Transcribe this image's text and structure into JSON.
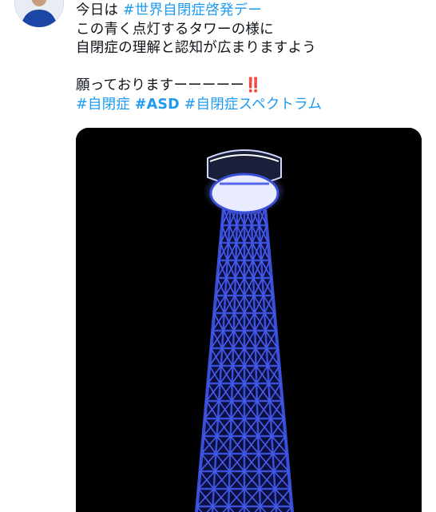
{
  "tweet": {
    "avatar_icon": "user-avatar",
    "lines": [
      {
        "parts": [
          {
            "text": "今日は "
          },
          {
            "text": "#世界自閉症啓発デー",
            "hashtag": true
          }
        ]
      },
      {
        "parts": [
          {
            "text": "この青く点灯するタワーの様に"
          }
        ]
      },
      {
        "parts": [
          {
            "text": "自閉症の理解と認知が広まりますよう"
          }
        ]
      },
      {
        "blank": true
      },
      {
        "parts": [
          {
            "text": "願っておりますーーーーー"
          },
          {
            "text": "‼️",
            "emoji": true
          }
        ]
      },
      {
        "parts": [
          {
            "text": "#自閉症",
            "hashtag": true
          },
          {
            "text": " "
          },
          {
            "text": "#ASD",
            "hashtag": true,
            "bold": true
          },
          {
            "text": " "
          },
          {
            "text": "#自閉症スペクトラム",
            "hashtag": true
          }
        ]
      }
    ],
    "media": {
      "subject": "blue-illuminated-tower-at-night",
      "background_color": "#000000",
      "light_color": "#3a4fd8"
    }
  }
}
